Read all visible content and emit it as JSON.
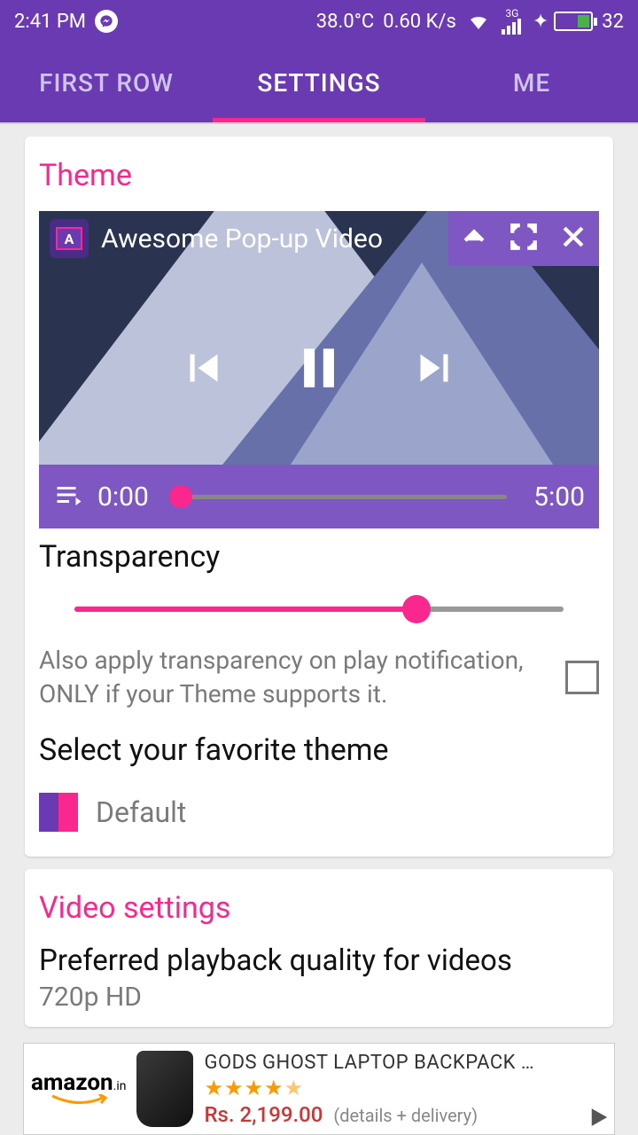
{
  "status": {
    "time": "2:41 PM",
    "temp": "38.0°C",
    "speed": "0.60 K/s",
    "network_label": "3G",
    "battery": "32"
  },
  "tabs": {
    "first": "FIRST ROW",
    "settings": "SETTINGS",
    "me": "ME"
  },
  "theme": {
    "title": "Theme",
    "video_title": "Awesome Pop-up Video",
    "badge_letter": "A",
    "time_current": "0:00",
    "time_total": "5:00",
    "transparency_label": "Transparency",
    "transparency_percent": 70,
    "checkbox_label": "Also apply transparency on play notification, ONLY if your Theme supports it.",
    "select_label": "Select your favorite theme",
    "theme_name": "Default"
  },
  "video_settings": {
    "title": "Video settings",
    "quality_label": "Preferred playback quality for videos",
    "quality_value": "720p HD"
  },
  "ad": {
    "logo_main": "amazon",
    "logo_domain": ".in",
    "product": "GODS GHOST LAPTOP BACKPACK …",
    "price": "Rs. 2,199.00",
    "extra": "(details + delivery)",
    "rating": 4.5
  },
  "colors": {
    "primary": "#6a3ab2",
    "accent": "#f9278e",
    "purple_light": "#7e57c2"
  }
}
